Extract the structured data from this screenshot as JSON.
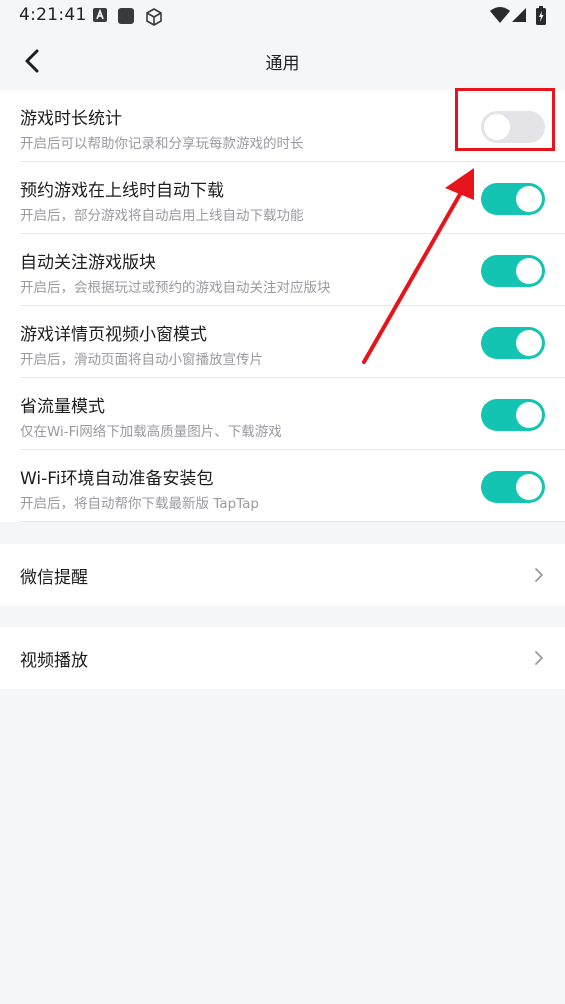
{
  "status_bar": {
    "time": "4:21:41",
    "left_icons": [
      "accessibility-icon",
      "square-app-icon",
      "cube-icon"
    ],
    "right_icons": [
      "wifi-icon",
      "signal-icon",
      "battery-charging-icon"
    ]
  },
  "header": {
    "back_icon": "chevron-left-icon",
    "title": "通用"
  },
  "settings": [
    {
      "title": "游戏时长统计",
      "subtitle": "开启后可以帮助你记录和分享玩每款游戏的时长",
      "enabled": false
    },
    {
      "title": "预约游戏在上线时自动下载",
      "subtitle": "开启后，部分游戏将自动启用上线自动下载功能",
      "enabled": true
    },
    {
      "title": "自动关注游戏版块",
      "subtitle": "开启后，会根据玩过或预约的游戏自动关注对应版块",
      "enabled": true
    },
    {
      "title": "游戏详情页视频小窗模式",
      "subtitle": "开启后，滑动页面将自动小窗播放宣传片",
      "enabled": true
    },
    {
      "title": "省流量模式",
      "subtitle": "仅在Wi-Fi网络下加载高质量图片、下载游戏",
      "enabled": true
    },
    {
      "title": "Wi-Fi环境自动准备安装包",
      "subtitle": "开启后，将自动帮你下载最新版 TapTap",
      "enabled": true
    }
  ],
  "nav_items": [
    {
      "label": "微信提醒",
      "icon": "chevron-right-icon"
    },
    {
      "label": "视频播放",
      "icon": "chevron-right-icon"
    }
  ],
  "colors": {
    "toggle_on": "#14c4b2",
    "toggle_off": "#e4e4e8",
    "annotation_red": "#e8141c",
    "background": "#f5f6f8"
  }
}
